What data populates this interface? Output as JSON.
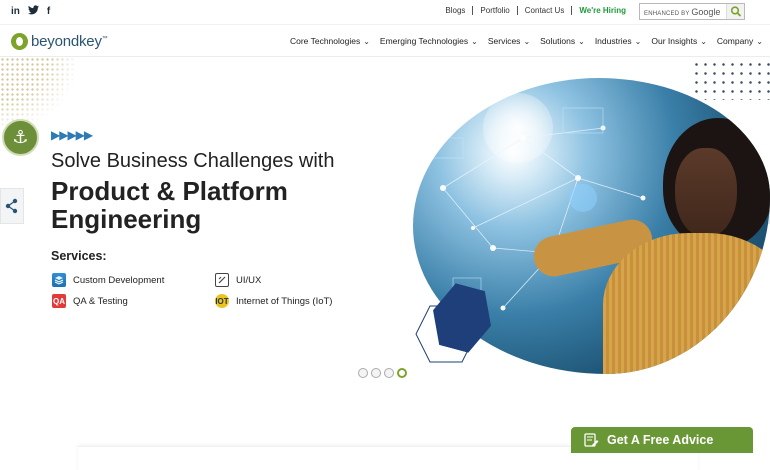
{
  "social": {
    "linkedin": "in",
    "twitter": "🐦",
    "facebook": "f",
    "icons": [
      "linkedin-icon",
      "twitter-icon",
      "facebook-icon"
    ]
  },
  "top_links": [
    "Blogs",
    "Portfolio",
    "Contact Us",
    "We're Hiring"
  ],
  "search": {
    "enhanced_by": "ENHANCED BY",
    "provider": "Google",
    "button_icon": "search-icon"
  },
  "logo": {
    "text": "beyondkey",
    "tm": "™"
  },
  "nav": [
    "Core Technologies",
    "Emerging Technologies",
    "Services",
    "Solutions",
    "Industries",
    "Our Insights",
    "Company"
  ],
  "hero": {
    "subheading": "Solve Business Challenges with",
    "headline_line1": "Product & Platform",
    "headline_line2": "Engineering",
    "arrows": "▶▶▶▶▶",
    "services_title": "Services:",
    "services": [
      {
        "label": "Custom Development",
        "icon": "layers-icon"
      },
      {
        "label": "UI/UX",
        "icon": "design-tools-icon"
      },
      {
        "label": "QA & Testing",
        "icon": "qa-testing-icon"
      },
      {
        "label": "Internet of Things (IoT)",
        "icon": "iot-icon"
      }
    ],
    "qa_icon_text": "QA",
    "iot_icon_text": "IOT"
  },
  "carousel": {
    "total": 4,
    "active_index": 3
  },
  "cta": {
    "label": "Get A Free Advice"
  },
  "colors": {
    "brand_green": "#6a9736",
    "hiring_green": "#1f9a3a",
    "arrow_blue": "#2d7ab5",
    "hex_navy": "#1e3f7a",
    "logo_blue": "#2b5572"
  }
}
